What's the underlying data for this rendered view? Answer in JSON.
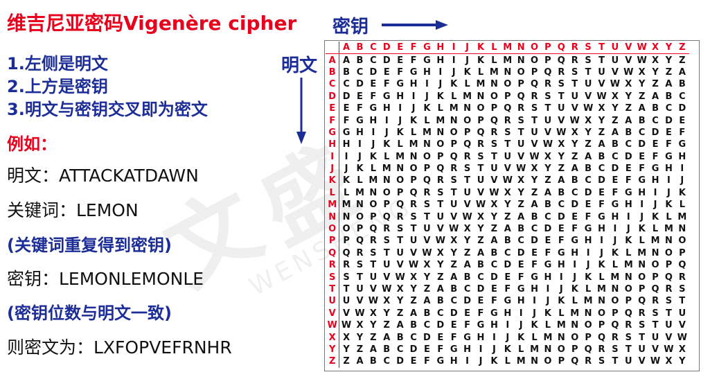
{
  "title": "维吉尼亚密码Vigenère cipher",
  "rules": [
    "1.左侧是明文",
    "2.上方是密钥",
    "3.明文与密钥交叉即为密文"
  ],
  "example_label": "例如：",
  "lines": {
    "plaintext": "明文：ATTACKATDAWN",
    "keyword": "关键词：LEMON",
    "keyword_note": "(关键词重复得到密钥)",
    "key": "密钥：LEMONLEMONLE",
    "key_note": "(密钥位数与明文一致)",
    "ciphertext": "则密文为：LXFOPVEFRNHR"
  },
  "table_labels": {
    "key": "密钥",
    "plaintext": "明文"
  },
  "alphabet": "ABCDEFGHIJKLMNOPQRSTUVWXYZ",
  "watermark": "WENSHENG",
  "colors": {
    "red": "#e8001c",
    "blue": "#1c2d97",
    "text": "#111111"
  }
}
